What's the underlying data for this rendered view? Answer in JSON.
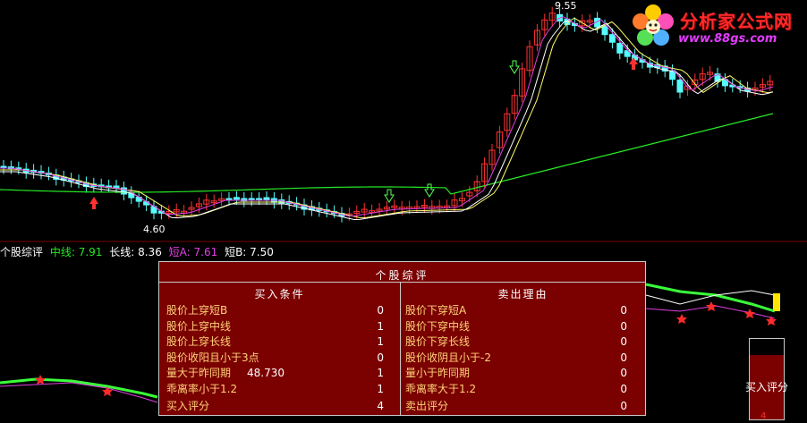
{
  "legend": {
    "title": "个股综评",
    "items": [
      {
        "label": "中线: 7.91",
        "color": "#25e825"
      },
      {
        "label": "长线: 8.36",
        "color": "#ffffff"
      },
      {
        "label": "短A: 7.61",
        "color": "#e040e0"
      },
      {
        "label": "短B: 7.50",
        "color": "#ffffff"
      }
    ]
  },
  "annotations": {
    "high_label": "9.55",
    "low_label": "4.60"
  },
  "logo": {
    "title": "分析家公式网",
    "url": "www.88gs.com"
  },
  "panel": {
    "title": "个股综评",
    "buy": {
      "header": "买入条件",
      "rows": [
        {
          "name": "股价上穿短B",
          "extra": "",
          "value": "0"
        },
        {
          "name": "股价上穿中线",
          "extra": "",
          "value": "1"
        },
        {
          "name": "股价上穿长线",
          "extra": "",
          "value": "1"
        },
        {
          "name": "股价收阳且小于3点",
          "extra": "",
          "value": "0"
        },
        {
          "name": "量大于昨同期",
          "extra": "48.730",
          "value": "1"
        },
        {
          "name": "乖离率小于1.2",
          "extra": "",
          "value": "1"
        }
      ],
      "total_label": "买入评分",
      "total_value": "4"
    },
    "sell": {
      "header": "卖出理由",
      "rows": [
        {
          "name": "股价下穿短A",
          "value": "0"
        },
        {
          "name": "股价下穿中线",
          "value": "0"
        },
        {
          "name": "股价下穿长线",
          "value": "0"
        },
        {
          "name": "股价收阴且小于-2",
          "value": "0"
        },
        {
          "name": "量小于昨同期",
          "value": "0"
        },
        {
          "name": "乖离率大于1.2",
          "value": "0"
        }
      ],
      "total_label": "卖出评分",
      "total_value": "0"
    }
  },
  "score": {
    "label": "买入评分",
    "value": "4",
    "fill_fraction": 0.8
  },
  "colors": {
    "up": "#ff3232",
    "down": "#54ffff",
    "ma_long": "#25e825",
    "ma_mid": "#ffff66",
    "ma_short": "#e040e0",
    "panel_bg": "#7b0000"
  }
}
